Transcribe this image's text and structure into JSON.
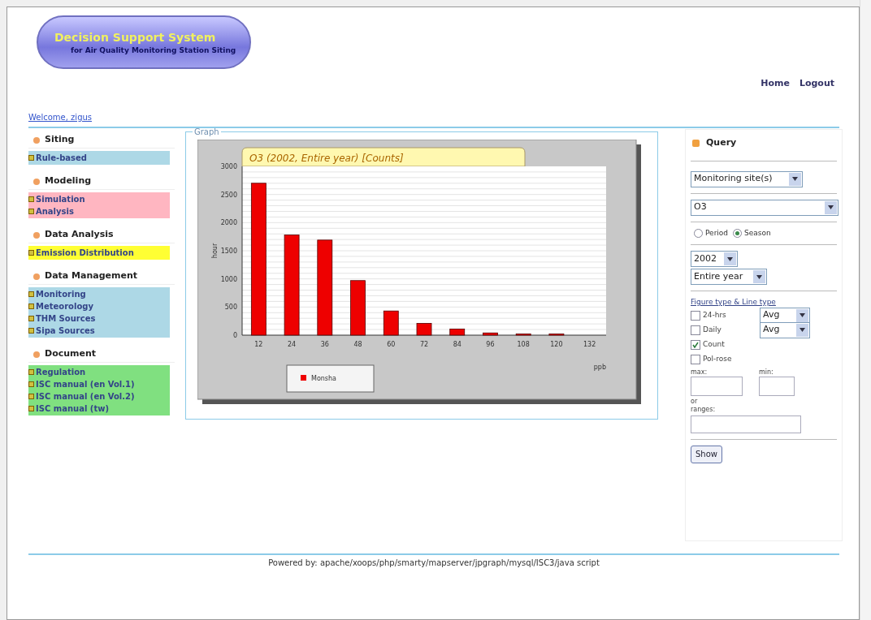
{
  "header": {
    "logo_title": "Decision Support System",
    "logo_subtitle": "for Air Quality Monitoring Station Siting",
    "nav_links": [
      "Home",
      "Logout"
    ],
    "welcome": "Welcome, zigus"
  },
  "sidebar": {
    "sections": [
      {
        "title": "Siting",
        "color": "#add8e6",
        "items": [
          "Rule-based"
        ]
      },
      {
        "title": "Modeling",
        "color": "#ffb6c1",
        "items": [
          "Simulation",
          "Analysis"
        ]
      },
      {
        "title": "Data Analysis",
        "color": "#ffff33",
        "items": [
          "Emission Distribution"
        ]
      },
      {
        "title": "Data Management",
        "color": "#add8e6",
        "items": [
          "Monitoring",
          "Meteorology",
          "THM Sources",
          "Sipa Sources"
        ]
      },
      {
        "title": "Document",
        "color": "#80e080",
        "items": [
          "Regulation",
          "ISC manual (en Vol.1)",
          "ISC manual (en Vol.2)",
          "ISC manual (tw)"
        ]
      }
    ]
  },
  "graph": {
    "legend": "Graph",
    "chart_data": {
      "type": "bar",
      "title": "O3 (2002, Entire year) [Counts]",
      "xlabel": "ppb",
      "ylabel": "hour",
      "categories": [
        "12",
        "24",
        "36",
        "48",
        "60",
        "72",
        "84",
        "96",
        "108",
        "120",
        "132"
      ],
      "series": [
        {
          "name": "Monsha",
          "color": "#ee0000",
          "values": [
            2700,
            1780,
            1690,
            970,
            430,
            210,
            110,
            40,
            10,
            10,
            0
          ]
        }
      ],
      "ylim": [
        0,
        3000
      ],
      "grid": true,
      "yticks": [
        0,
        500,
        1000,
        1500,
        2000,
        2500,
        3000
      ]
    }
  },
  "query": {
    "title": "Query",
    "site_select": "Monitoring site(s)",
    "pollutant": "O3",
    "mode_options": [
      {
        "label": "Period",
        "selected": false
      },
      {
        "label": "Season",
        "selected": true
      }
    ],
    "year": "2002",
    "season": "Entire year",
    "figure_heading": "Figure type & Line type",
    "figure_types": [
      {
        "label": "24-hrs",
        "checked": false,
        "line_type": "Avg"
      },
      {
        "label": "Daily",
        "checked": false,
        "line_type": "Avg"
      },
      {
        "label": "Count",
        "checked": true
      },
      {
        "label": "Pol-rose",
        "checked": false
      }
    ],
    "max_label": "max:",
    "min_label": "min:",
    "or_label": "or",
    "ranges_label": "ranges:",
    "button": "Show"
  },
  "footer": "Powered by: apache/xoops/php/smarty/mapserver/jpgraph/mysql/ISC3/java script"
}
